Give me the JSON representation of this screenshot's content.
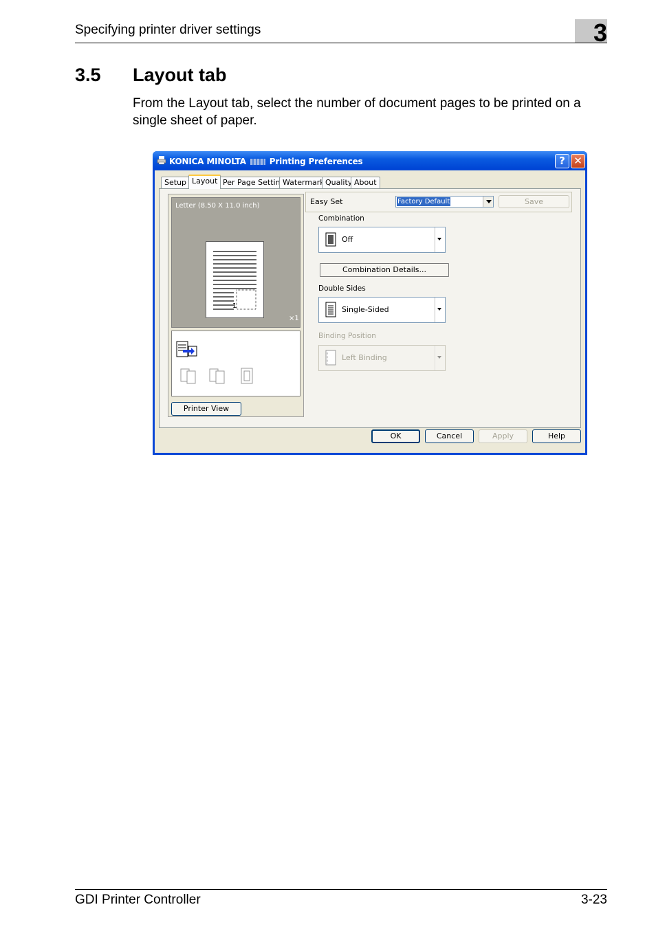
{
  "header": {
    "title": "Specifying printer driver settings",
    "chapter": "3"
  },
  "section": {
    "number": "3.5",
    "title": "Layout tab"
  },
  "intro": "From the Layout tab, select the number of document pages to be printed on a single sheet of paper.",
  "dialog": {
    "title": "KONICA MINOLTA",
    "title_suffix": "Printing Preferences",
    "help_glyph": "?",
    "close_glyph": "✕",
    "tabs": [
      "Setup",
      "Layout",
      "Per Page Setting",
      "Watermark",
      "Quality",
      "About"
    ],
    "active_tab": "Layout",
    "preview": {
      "paper": "Letter  (8.50 X 11.0 inch)",
      "copies": "×1",
      "page_number": "1"
    },
    "printer_view_button": "Printer View",
    "easy_set": {
      "label": "Easy Set",
      "value": "Factory Default",
      "save": "Save"
    },
    "combination": {
      "label": "Combination",
      "value": "Off",
      "details_button": "Combination Details..."
    },
    "double_sides": {
      "label": "Double Sides",
      "value": "Single-Sided"
    },
    "binding_position": {
      "label": "Binding Position",
      "value": "Left Binding"
    },
    "buttons": {
      "ok": "OK",
      "cancel": "Cancel",
      "apply": "Apply",
      "help": "Help"
    },
    "colors": {
      "titlebar": "#0a5be0",
      "face": "#ece9d8",
      "selection": "#316ac5"
    }
  },
  "footer": {
    "left": "GDI Printer Controller",
    "right": "3-23"
  }
}
